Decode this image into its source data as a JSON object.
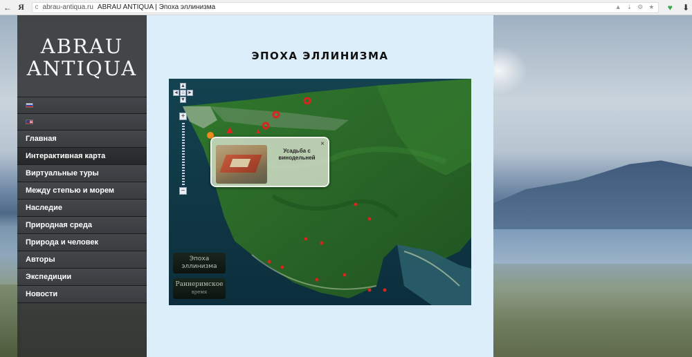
{
  "browser": {
    "back_icon": "back-arrow-icon",
    "yandex_logo": "Я",
    "url": "abrau-antiqua.ru",
    "tab_title": "ABRAU ANTIQUA | Эпоха эллинизма",
    "back_glyph": "←",
    "reload_glyph": "c",
    "download_glyph": "⬇",
    "shield_glyph": "♥",
    "icons": [
      "reader-icon",
      "download-page-icon",
      "settings-icon",
      "bookmark-star-icon"
    ],
    "icon_glyphs": [
      "▲",
      "⇣",
      "⚙",
      "★"
    ]
  },
  "sidebar": {
    "logo_line1": "ABRAU",
    "logo_line2": "ANTIQUA",
    "languages": [
      {
        "code": "ru",
        "icon": "flag-russia-icon"
      },
      {
        "code": "en",
        "icon": "flag-usa-icon"
      }
    ],
    "menu": [
      {
        "label": "Главная",
        "active": false
      },
      {
        "label": "Интерактивная карта",
        "active": true
      },
      {
        "label": "Виртуальные туры",
        "active": false
      },
      {
        "label": "Между степью и морем",
        "active": false
      },
      {
        "label": "Наследие",
        "active": false
      },
      {
        "label": "Природная среда",
        "active": false
      },
      {
        "label": "Природа и человек",
        "active": false
      },
      {
        "label": "Авторы",
        "active": false
      },
      {
        "label": "Экспедиции",
        "active": false
      },
      {
        "label": "Новости",
        "active": false
      }
    ]
  },
  "page": {
    "title": "Эпоха эллинизма"
  },
  "map": {
    "popup_title": "Усадьба с винодельней",
    "popup_close": "×",
    "zoom_in": "+",
    "zoom_out": "−",
    "pan_up": "▲",
    "pan_down": "▼",
    "pan_left": "◄",
    "pan_right": "►",
    "pan_home": "⌂",
    "era_buttons": [
      {
        "label": "Эпоха эллинизма",
        "sub": ""
      },
      {
        "label": "Раннеримское",
        "sub": "время"
      }
    ],
    "marker_color": "#d9251f",
    "highlight_marker_color": "#f08a1c"
  },
  "colors": {
    "content_bg": "#ddeefb",
    "sidebar_bg": "#3a3d40",
    "map_land": "#2e6b2a",
    "map_sea": "#0f3a4a"
  }
}
